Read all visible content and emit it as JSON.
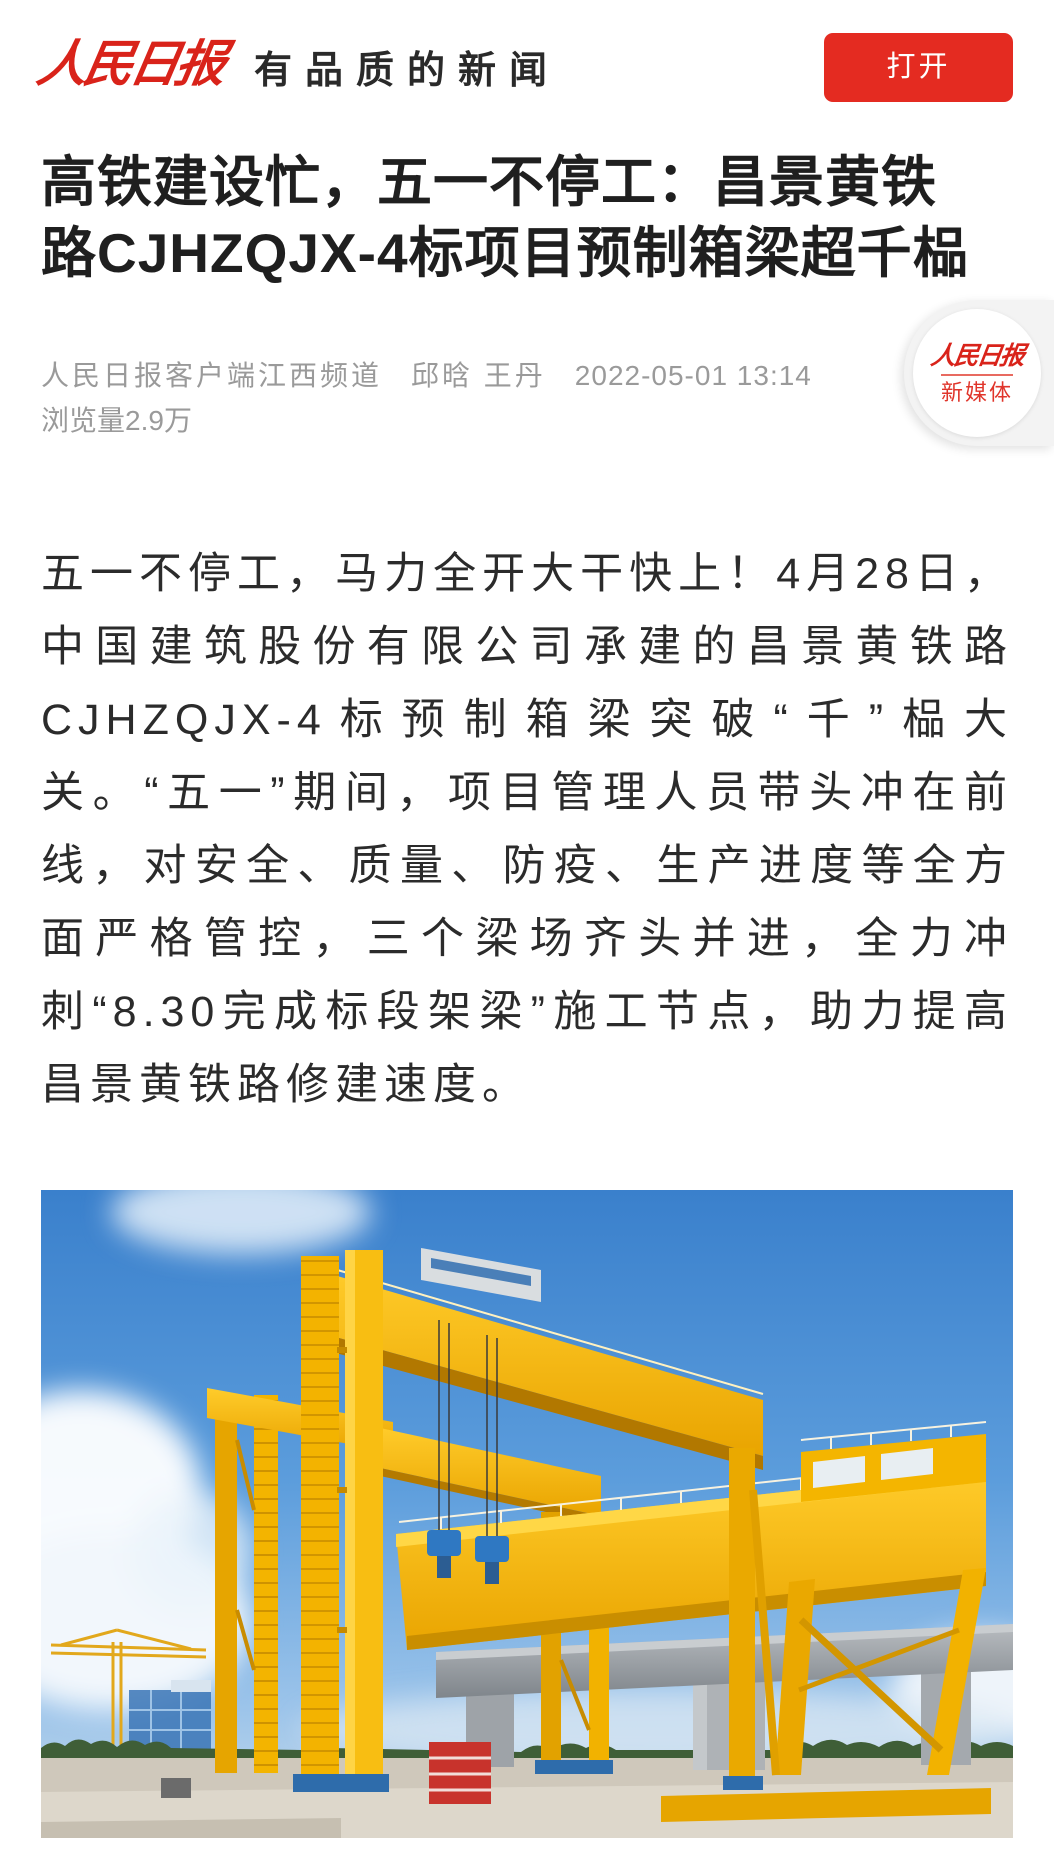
{
  "header": {
    "logo_text": "人民日报",
    "slogan": "有品质的新闻",
    "open_button_label": "打开"
  },
  "article": {
    "title_lines": [
      "高铁建设忙，五一不停工：昌景黄铁",
      "路CJHZQJX-4标项目预制箱梁超千榀"
    ],
    "meta": {
      "source": "人民日报客户端江西频道",
      "authors": "邱晗 王丹",
      "published_at": "2022-05-01 13:14",
      "views_label": "浏览量",
      "views_count": "2.9万"
    },
    "body": "五一不停工，马力全开大干快上！4月28日，中国建筑股份有限公司承建的昌景黄铁路CJHZQJX-4标预制箱梁突破“千”榀大关。“五一”期间，项目管理人员带头冲在前线，对安全、质量、防疫、生产进度等全方面严格管控，三个梁场齐头并进，全力冲刺“8.30完成标段架梁”施工节点，助力提高昌景黄铁路修建速度。"
  },
  "floating_badge": {
    "logo_text": "人民日报",
    "subtitle": "新媒体"
  },
  "colors": {
    "brand_red": "#e42b21",
    "logo_red": "#d9231a",
    "title_text": "#1f1f1f",
    "body_text": "#2b2b2b",
    "meta_text": "#9a9a9a"
  }
}
